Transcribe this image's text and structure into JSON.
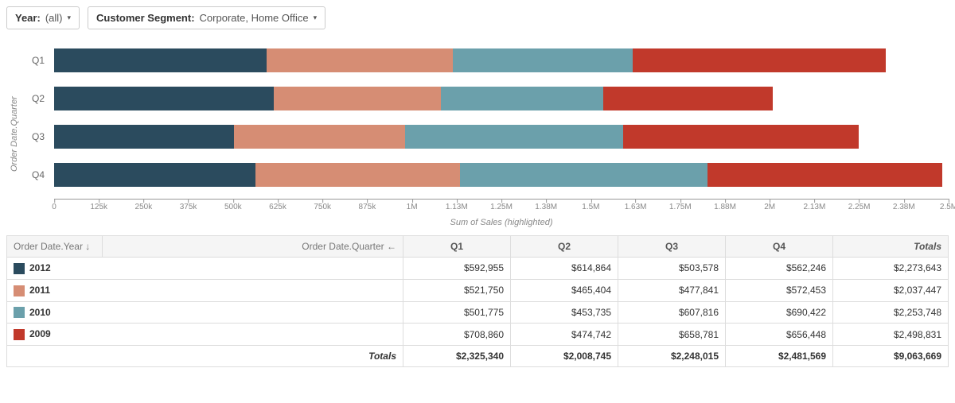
{
  "filters": {
    "year_label": "Year:",
    "year_value": "(all)",
    "segment_label": "Customer Segment:",
    "segment_value": "Corporate, Home Office"
  },
  "chart_data": {
    "type": "bar",
    "orientation": "horizontal",
    "stacked": true,
    "categories": [
      "Q1",
      "Q2",
      "Q3",
      "Q4"
    ],
    "series": [
      {
        "name": "2012",
        "color": "#2b4b5e",
        "values": [
          592955,
          614864,
          503578,
          562246
        ]
      },
      {
        "name": "2011",
        "color": "#d68d74",
        "values": [
          521750,
          465404,
          477841,
          572453
        ]
      },
      {
        "name": "2010",
        "color": "#6ba0ab",
        "values": [
          501775,
          453735,
          607816,
          690422
        ]
      },
      {
        "name": "2009",
        "color": "#c1392b",
        "values": [
          708860,
          474742,
          658781,
          656448
        ]
      }
    ],
    "ylabel": "Order Date.Quarter",
    "xlabel": "Sum of Sales (highlighted)",
    "xlim": [
      0,
      2500000
    ],
    "xticks": [
      "0",
      "125k",
      "250k",
      "375k",
      "500k",
      "625k",
      "750k",
      "875k",
      "1M",
      "1.13M",
      "1.25M",
      "1.38M",
      "1.5M",
      "1.63M",
      "1.75M",
      "1.88M",
      "2M",
      "2.13M",
      "2.25M",
      "2.38M",
      "2.5M"
    ]
  },
  "table": {
    "header_year": "Order Date.Year ↓",
    "header_quarter": "Order Date.Quarter ←",
    "col_q1": "Q1",
    "col_q2": "Q2",
    "col_q3": "Q3",
    "col_q4": "Q4",
    "col_totals": "Totals",
    "rows": [
      {
        "year": "2012",
        "color": "#2b4b5e",
        "q1": "$592,955",
        "q2": "$614,864",
        "q3": "$503,578",
        "q4": "$562,246",
        "total": "$2,273,643"
      },
      {
        "year": "2011",
        "color": "#d68d74",
        "q1": "$521,750",
        "q2": "$465,404",
        "q3": "$477,841",
        "q4": "$572,453",
        "total": "$2,037,447"
      },
      {
        "year": "2010",
        "color": "#6ba0ab",
        "q1": "$501,775",
        "q2": "$453,735",
        "q3": "$607,816",
        "q4": "$690,422",
        "total": "$2,253,748"
      },
      {
        "year": "2009",
        "color": "#c1392b",
        "q1": "$708,860",
        "q2": "$474,742",
        "q3": "$658,781",
        "q4": "$656,448",
        "total": "$2,498,831"
      }
    ],
    "totals_label": "Totals",
    "totals": {
      "q1": "$2,325,340",
      "q2": "$2,008,745",
      "q3": "$2,248,015",
      "q4": "$2,481,569",
      "total": "$9,063,669"
    }
  }
}
